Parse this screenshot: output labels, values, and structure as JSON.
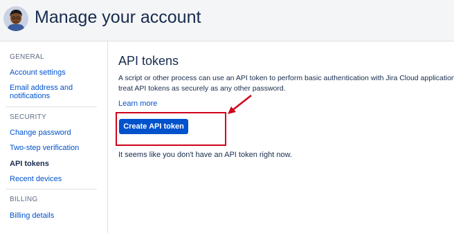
{
  "header": {
    "title": "Manage your account"
  },
  "sidebar": {
    "sections": [
      {
        "heading": "GENERAL",
        "items": [
          "Account settings",
          "Email address and notifications"
        ]
      },
      {
        "heading": "SECURITY",
        "items": [
          "Change password",
          "Two-step verification",
          "API tokens",
          "Recent devices"
        ]
      },
      {
        "heading": "BILLING",
        "items": [
          "Billing details"
        ]
      }
    ],
    "active_item": "API tokens"
  },
  "main": {
    "title": "API tokens",
    "description_line1": "A script or other process can use an API token to perform basic authentication with Jira Cloud applications",
    "description_line2": "treat API tokens as securely as any other password.",
    "learn_more": "Learn more",
    "create_button": "Create API token",
    "empty_message": "It seems like you don't have an API token right now."
  },
  "colors": {
    "link": "#0052cc",
    "primary_button": "#0052cc",
    "annotation": "#d0021b",
    "header_bg": "#f4f5f7"
  }
}
